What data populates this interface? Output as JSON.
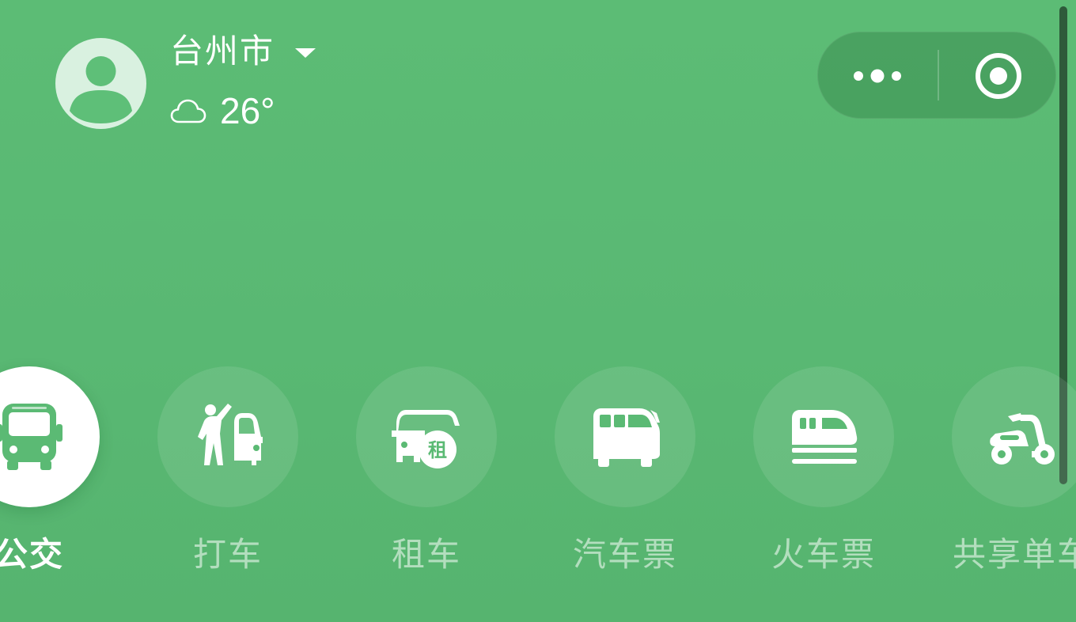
{
  "header": {
    "city": "台州市",
    "weather_icon": "cloud-icon",
    "temperature": "26°"
  },
  "capsule": {
    "more_icon": "more-dots-icon",
    "close_icon": "target-close-icon"
  },
  "services": [
    {
      "label": "公交",
      "icon": "bus-icon",
      "active": true
    },
    {
      "label": "打车",
      "icon": "hail-car-icon",
      "active": false
    },
    {
      "label": "租车",
      "icon": "rent-car-icon",
      "badge": "租",
      "active": false
    },
    {
      "label": "汽车票",
      "icon": "coach-icon",
      "active": false
    },
    {
      "label": "火车票",
      "icon": "train-icon",
      "active": false
    },
    {
      "label": "共享单车",
      "icon": "scooter-icon",
      "active": false
    }
  ],
  "colors": {
    "background": "#5bba74",
    "active_icon": "#5bba74",
    "avatar_bg": "#d9f1e0",
    "avatar_figure": "#5ebf78",
    "scrollbar": "#2e5a3a"
  }
}
